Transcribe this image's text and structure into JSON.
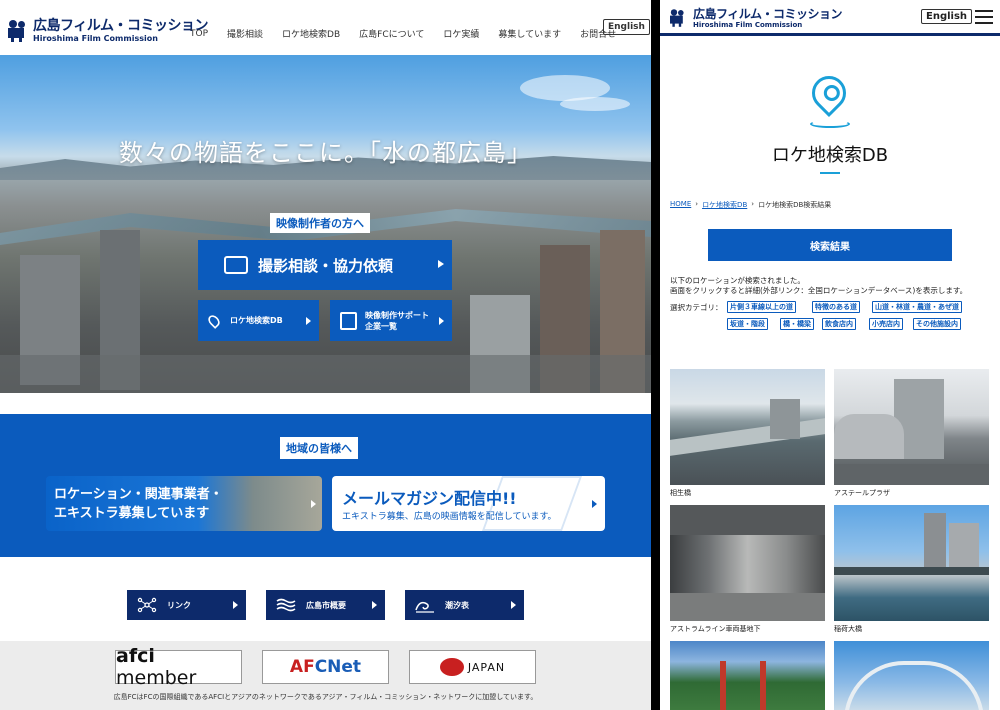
{
  "desktop": {
    "logo": {
      "ja": "広島フィルム・コミッション",
      "en": "Hiroshima Film Commission"
    },
    "nav": [
      "TOP",
      "撮影相談",
      "ロケ地検索DB",
      "広島FCについて",
      "ロケ実績",
      "募集しています",
      "お問合せ"
    ],
    "english_label": "English",
    "hero": {
      "title": "数々の物語をここに。「水の都広島」",
      "tag": "映像制作者の方へ",
      "main_button": "撮影相談・協力依頼",
      "sub_buttons": [
        "ロケ地検索DB",
        "映像制作サポート\n企業一覧"
      ]
    },
    "community": {
      "tag": "地域の皆様へ",
      "card1": "ロケーション・関連事業者・\nエキストラ募集しています",
      "card2_title": "メールマガジン配信中!!",
      "card2_sub": "エキストラ募集、広島の映画情報を配信しています。"
    },
    "small_buttons": [
      "リンク",
      "広島市概要",
      "潮汐表"
    ],
    "banners": {
      "afci": "afci",
      "afci_member": "member",
      "afcnet_a": "AF",
      "afcnet_b": "CNet",
      "japan": "JAPAN"
    },
    "footer_note": "広島FCはFCの国際組織であるAFCIとアジアのネットワークであるアジア・フィルム・コミッション・ネットワークに加盟しています。"
  },
  "mobile": {
    "logo": {
      "ja": "広島フィルム・コミッション",
      "en": "Hiroshima Film Commission"
    },
    "english_label": "English",
    "page_title": "ロケ地検索DB",
    "breadcrumb": [
      "HOME",
      "ロケ地検索DB",
      "ロケ地検索DB検索結果"
    ],
    "result_button": "検索結果",
    "description": [
      "以下のロケーションが検索されました。",
      "画面をクリックすると詳細(外部リンク：全国ロケーションデータベース)を表示します。"
    ],
    "category_label": "選択カテゴリ：",
    "categories": [
      "片側３車線以上の道",
      "特徴のある道",
      "山道・林道・農道・あぜ道",
      "坂道・階段",
      "橋・橋梁",
      "飲食店内",
      "小売店内",
      "その他施設内"
    ],
    "results": [
      {
        "caption": "相生橋"
      },
      {
        "caption": "アステールプラザ"
      },
      {
        "caption": "アストラムライン車両基地下"
      },
      {
        "caption": "稲荷大橋"
      },
      {
        "caption": ""
      },
      {
        "caption": ""
      }
    ]
  },
  "colors": {
    "brand_blue": "#0b5bbd",
    "navy": "#0d2a6b",
    "accent_cyan": "#1aa0d8"
  }
}
